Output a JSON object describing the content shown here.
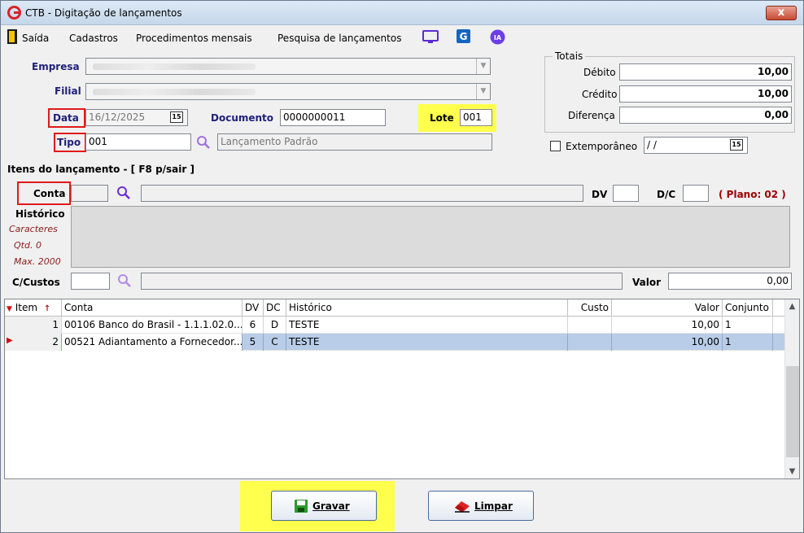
{
  "window": {
    "title": "CTB - Digitação de lançamentos",
    "close_label": "x"
  },
  "menu": {
    "items": [
      "Saída",
      "Cadastros",
      "Procedimentos mensais",
      "Pesquisa de lançamentos"
    ],
    "ia_label": "IA"
  },
  "header": {
    "empresa_label": "Empresa",
    "filial_label": "Filial",
    "data_label": "Data",
    "data_value": "16/12/2025",
    "documento_label": "Documento",
    "documento_value": "0000000011",
    "lote_label": "Lote",
    "lote_value": "001",
    "tipo_label": "Tipo",
    "tipo_value": "001",
    "tipo_desc": "Lançamento Padrão",
    "calendar_label": "15"
  },
  "totais": {
    "legend": "Totais",
    "debito_label": "Débito",
    "debito_value": "10,00",
    "credito_label": "Crédito",
    "credito_value": "10,00",
    "diferenca_label": "Diferença",
    "diferenca_value": "0,00",
    "extemporaneo_label": "Extemporâneo",
    "extemporaneo_value": " / /"
  },
  "items": {
    "section_title": "Itens do lançamento - [ F8 p/sair ]",
    "conta_label": "Conta",
    "dv_label": "DV",
    "dc_label": "D/C",
    "plano_label": "( Plano: 02 )",
    "historico_label": "Histórico",
    "caracteres_label": "Caracteres",
    "qtd_label": "Qtd. 0",
    "max_label": "Max. 2000",
    "ccustos_label": "C/Custos",
    "valor_label": "Valor",
    "valor_value": "0,00"
  },
  "grid": {
    "columns": [
      "Item",
      "Conta",
      "DV",
      "DC",
      "Histórico",
      "Custo",
      "Valor",
      "Conjunto"
    ],
    "rows": [
      {
        "item": "1",
        "conta": "00106 Banco do Brasil - 1.1.1.02.0...",
        "dv": "6",
        "dc": "D",
        "historico": "TESTE",
        "custo": "",
        "valor": "10,00",
        "conjunto": "1"
      },
      {
        "item": "2",
        "conta": "00521 Adiantamento a Fornecedor...",
        "dv": "5",
        "dc": "C",
        "historico": "TESTE",
        "custo": "",
        "valor": "10,00",
        "conjunto": "1"
      }
    ]
  },
  "buttons": {
    "gravar": "Gravar",
    "limpar": "Limpar"
  },
  "colors": {
    "highlight_yellow": "#ffff4d",
    "annotation_red": "#e01919",
    "selected_row": "#b9cde8",
    "plano_red": "#a00000"
  }
}
